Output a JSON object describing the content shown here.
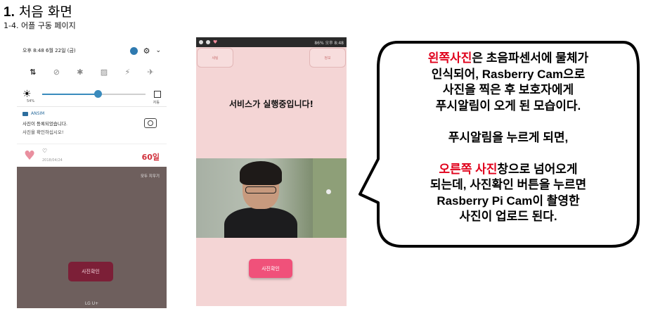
{
  "slide": {
    "number": "1.",
    "title": "처음 화면",
    "subtitle": "1-4. 어플 구동 페이지"
  },
  "left_phone": {
    "status_time": "오후 8:48 6월 22일 (금)",
    "brightness_pct_label": "54%",
    "brightness_level": 0.54,
    "auto_label": "자동",
    "notification": {
      "app": "ANSIM",
      "line1": "사진이 등록되었습니다.",
      "line2": "사진을 확인하십시오!"
    },
    "day_card": {
      "date": "2018/04/24",
      "days": "60일"
    },
    "clear_all": "모두 지우기",
    "button_label": "사진확인",
    "carrier": "LG U+"
  },
  "right_phone": {
    "status_right": "86% 오후 8:48",
    "btn_left_label": "세팅",
    "btn_right_label": "정보",
    "service_text": "서비스가 실행중입니다!",
    "button_label": "사진확인"
  },
  "bubble": {
    "l1_red": "왼쪽사진",
    "l1_rest": "은 초음파센서에 물체가",
    "l2": "인식되어, Rasberry Cam으로",
    "l3": "사진을 찍은 후 보호자에게",
    "l4": "푸시알림이 오게 된 모습이다.",
    "l5": "푸시알림을 누르게 되면,",
    "l6_red": "오른쪽 사진",
    "l6_rest": "창으로 넘어오게",
    "l7": "되는데, 사진확인 버튼을 누르면",
    "l8": "Rasberry Pi Cam이 촬영한",
    "l9": "사진이 업로드 된다."
  },
  "colors": {
    "accent_red": "#e0001b",
    "app_pink": "#f4d5d5",
    "button_pink": "#f0517a",
    "button_dark": "#7c1f37"
  }
}
